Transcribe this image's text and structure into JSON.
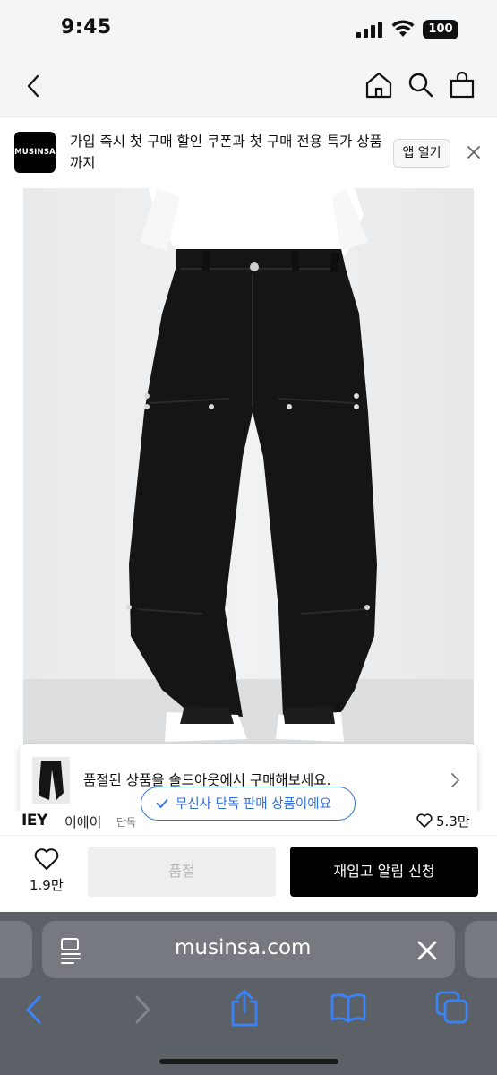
{
  "status_bar": {
    "time": "9:45",
    "battery": "100"
  },
  "nav": {
    "icons": [
      "back-chevron-icon",
      "home-icon",
      "search-icon",
      "shopping-bag-icon"
    ]
  },
  "banner": {
    "logo_text": "MUSINSA",
    "message": "가입 즉시 첫 구매 할인 쿠폰과 첫 구매 전용 특가 상품까지",
    "open_app_label": "앱 열기"
  },
  "soldout_notice": {
    "message": "품절된 상품을 솔드아웃에서 구매해보세요.",
    "exclusive_badge": "무신사 단독 판매 상품이에요"
  },
  "brand_row": {
    "brand_en": "IEY",
    "brand_kr": "이에이",
    "tag": "단독",
    "likes": "5.3만"
  },
  "action_bar": {
    "like_count": "1.9만",
    "soldout_label": "품절",
    "restock_label": "재입고 알림 신청"
  },
  "browser": {
    "url": "musinsa.com"
  },
  "colors": {
    "accent_blue": "#2f6fdb",
    "safari_bar": "#5c6168",
    "safari_icon_blue": "#3b82f6"
  }
}
